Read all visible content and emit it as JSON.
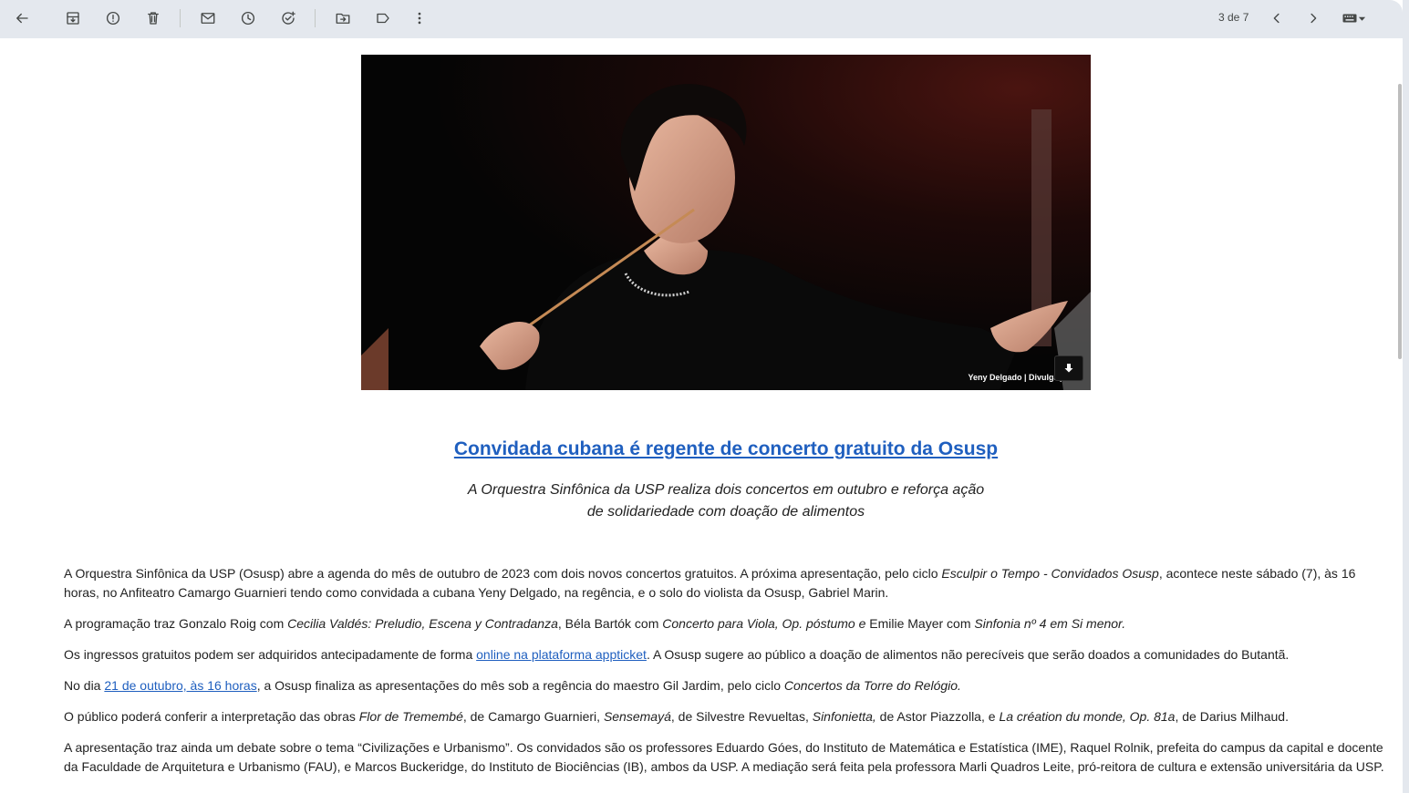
{
  "toolbar": {
    "pager_text": "3 de 7",
    "icons": [
      "back-arrow-icon",
      "archive-icon",
      "report-spam-icon",
      "delete-icon",
      "mark-unread-icon",
      "snooze-icon",
      "add-task-icon",
      "move-to-icon",
      "label-icon",
      "more-vert-icon",
      "chevron-left-icon",
      "chevron-right-icon",
      "keyboard-icon"
    ]
  },
  "hero": {
    "caption": "Yeny Delgado | Divulgação"
  },
  "article": {
    "headline": "Convidada cubana é regente de concerto gratuito da Osusp",
    "subtitle_line1": "A Orquestra Sinfônica da USP realiza dois concertos em outubro e reforça ação",
    "subtitle_line2": "de solidariedade com doação de alimentos",
    "p1": {
      "a": "A Orquestra Sinfônica da USP (Osusp) abre a agenda do mês de outubro de 2023 com dois novos concertos gratuitos. A próxima apresentação, pelo ciclo ",
      "b_italic": "Esculpir o Tempo - Convidados Osusp",
      "c": ", acontece neste sábado (7), às 16 horas, no Anfiteatro Camargo Guarnieri tendo como convidada a cubana Yeny Delgado, na regência, e o solo do violista da Osusp, Gabriel Marin."
    },
    "p2": {
      "a": "A programação traz Gonzalo Roig com ",
      "b_italic": "Cecilia Valdés: Preludio, Escena y Contradanza",
      "c": ", Béla Bartók com ",
      "d_italic": "Concerto para Viola, Op. póstumo e ",
      "e": "Emilie Mayer com ",
      "f_italic": "Sinfonia nº 4 em Si menor."
    },
    "p3": {
      "a": "Os ingressos gratuitos podem ser adquiridos antecipadamente de forma ",
      "link": "online na plataforma appticket",
      "c": ". A Osusp sugere ao público a doação de alimentos não perecíveis que serão doados a comunidades do Butantã."
    },
    "p4": {
      "a": "No dia ",
      "link": "21 de outubro, às 16 horas",
      "c": ", a Osusp finaliza as apresentações do mês sob a regência do maestro Gil Jardim, pelo ciclo ",
      "d_italic": "Concertos da Torre do Relógio."
    },
    "p5": {
      "a": "O público poderá conferir a interpretação das obras ",
      "b_italic": "Flor de Tremembé",
      "c": ", de Camargo Guarnieri, ",
      "d_italic": "Sensemayá",
      "e": ", de Silvestre Revueltas, ",
      "f_italic": "Sinfonietta,",
      "g": " de Astor Piazzolla, e ",
      "h_italic": "La création du monde, Op. 81a",
      "i": ", de Darius Milhaud."
    },
    "p6": "A apresentação traz ainda um debate sobre o tema “Civilizações e Urbanismo”. Os convidados são os professores Eduardo Góes, do Instituto de Matemática e Estatística (IME), Raquel Rolnik, prefeita do campus da capital e docente da Faculdade de Arquitetura e Urbanismo (FAU), e Marcos Buckeridge, do Instituto de Biociências (IB), ambos da USP. A mediação será feita pela professora Marli Quadros Leite, pró-reitora de cultura e extensão universitária da USP."
  }
}
